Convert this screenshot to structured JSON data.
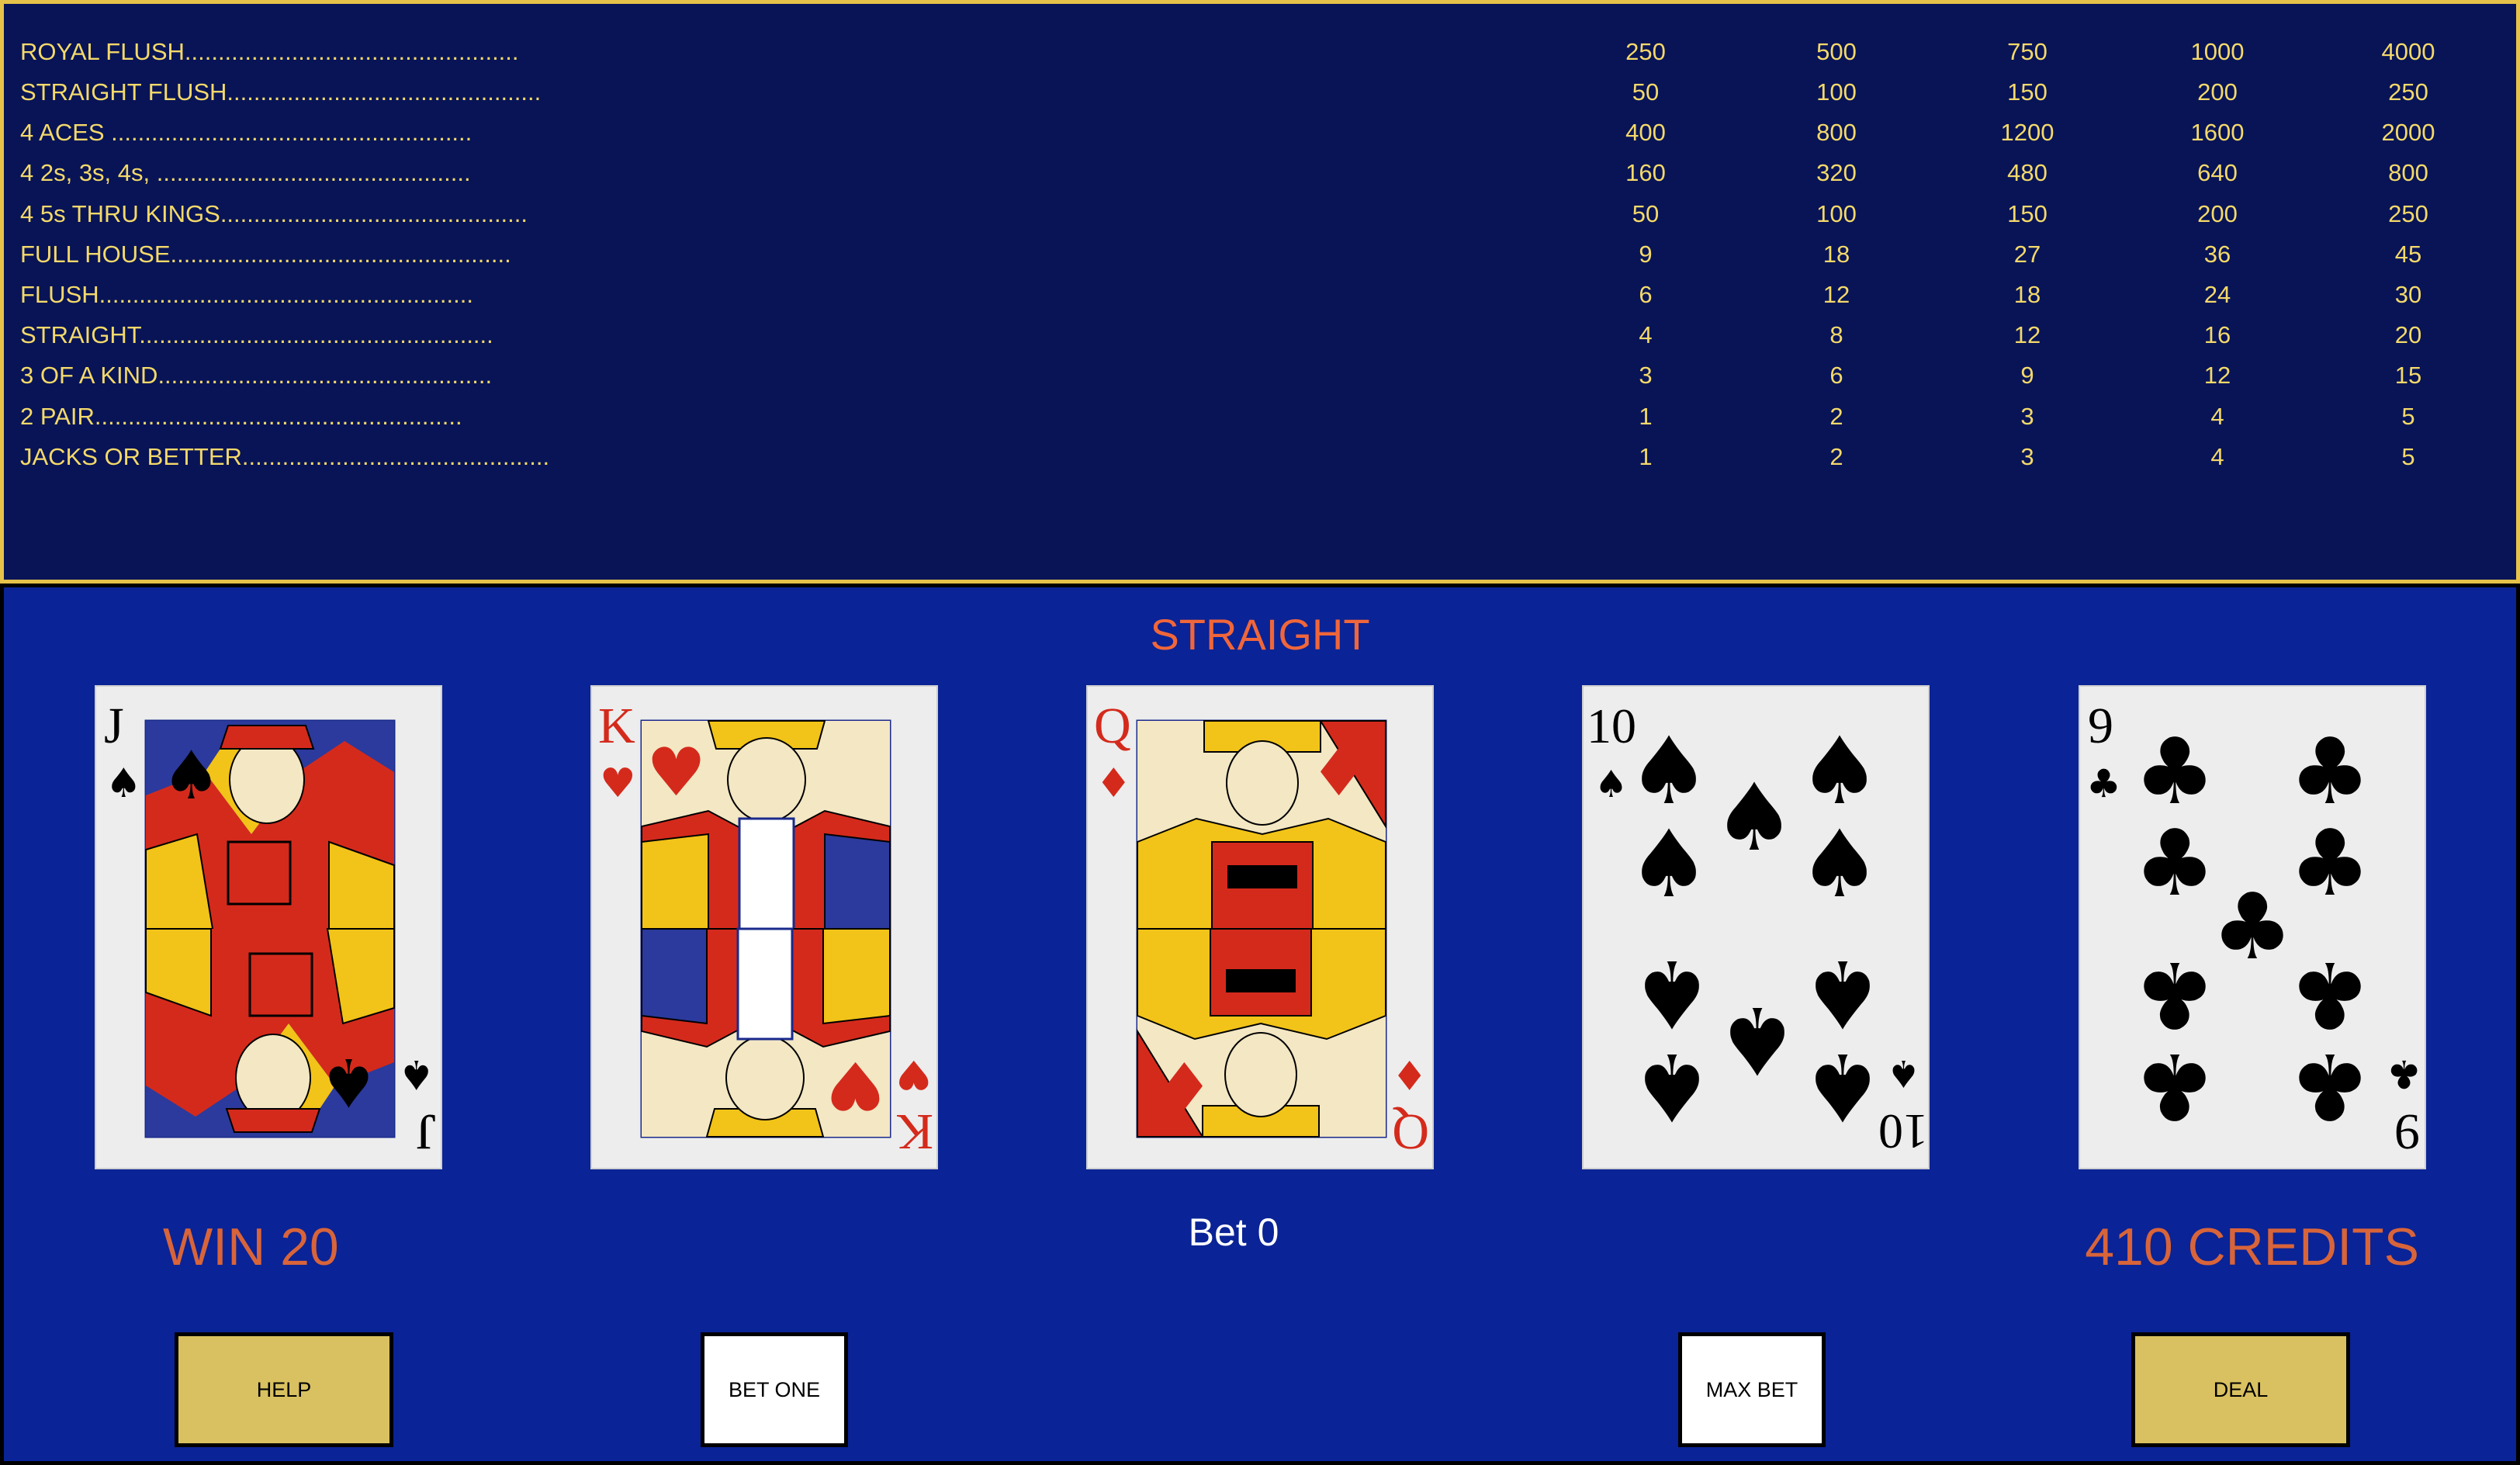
{
  "paytable": {
    "rows": [
      {
        "label": "ROYAL FLUSH..................................................",
        "values": [
          "250",
          "500",
          "750",
          "1000",
          "4000"
        ]
      },
      {
        "label": "STRAIGHT FLUSH...............................................",
        "values": [
          "50",
          "100",
          "150",
          "200",
          "250"
        ]
      },
      {
        "label": "4 ACES ......................................................",
        "values": [
          "400",
          "800",
          "1200",
          "1600",
          "2000"
        ]
      },
      {
        "label": "4 2s, 3s, 4s, ...............................................",
        "values": [
          "160",
          "320",
          "480",
          "640",
          "800"
        ]
      },
      {
        "label": "4 5s THRU KINGS..............................................",
        "values": [
          "50",
          "100",
          "150",
          "200",
          "250"
        ]
      },
      {
        "label": "FULL HOUSE...................................................",
        "values": [
          "9",
          "18",
          "27",
          "36",
          "45"
        ]
      },
      {
        "label": "FLUSH........................................................",
        "values": [
          "6",
          "12",
          "18",
          "24",
          "30"
        ]
      },
      {
        "label": "STRAIGHT.....................................................",
        "values": [
          "4",
          "8",
          "12",
          "16",
          "20"
        ]
      },
      {
        "label": "3 OF A KIND..................................................",
        "values": [
          "3",
          "6",
          "9",
          "12",
          "15"
        ]
      },
      {
        "label": "2 PAIR.......................................................",
        "values": [
          "1",
          "2",
          "3",
          "4",
          "5"
        ]
      },
      {
        "label": "JACKS OR BETTER..............................................",
        "values": [
          "1",
          "2",
          "3",
          "4",
          "5"
        ]
      }
    ]
  },
  "game": {
    "result": "STRAIGHT",
    "cards": [
      {
        "rank": "J",
        "suit": "spades",
        "suit_symbol": "♠",
        "color": "#000000"
      },
      {
        "rank": "K",
        "suit": "hearts",
        "suit_symbol": "♥",
        "color": "#d42a1c"
      },
      {
        "rank": "Q",
        "suit": "diamonds",
        "suit_symbol": "♦",
        "color": "#d42a1c"
      },
      {
        "rank": "10",
        "suit": "spades",
        "suit_symbol": "♠",
        "color": "#000000"
      },
      {
        "rank": "9",
        "suit": "clubs",
        "suit_symbol": "♣",
        "color": "#000000"
      }
    ],
    "win_text": "WIN 20",
    "bet_text": "Bet 0",
    "credits_text": "410 CREDITS"
  },
  "buttons": {
    "help": "HELP",
    "bet_one": "BET ONE",
    "max_bet": "MAX BET",
    "deal": "DEAL"
  },
  "colors": {
    "paytable_bg": "#081456",
    "paytable_text": "#f4d96a",
    "paytable_border": "#e6c24a",
    "game_bg": "#0a2396",
    "result_text": "#f0663a",
    "win_text": "#d8643a",
    "button_gold": "#d9c161"
  }
}
